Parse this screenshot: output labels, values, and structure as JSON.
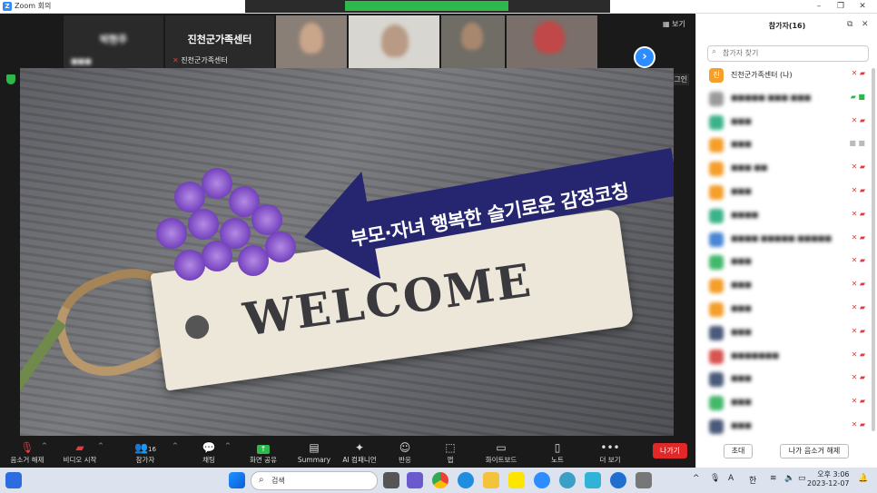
{
  "window": {
    "title": "Zoom 회의",
    "minimize": "–",
    "restore": "❐",
    "close": "✕"
  },
  "video_strip": {
    "tile1_name": "박현주",
    "host_tile_name": "진천군가족센터",
    "host_tile_label": "진천군가족센터",
    "view_label": "보기",
    "next_label": "›"
  },
  "share": {
    "login_label": "로그인",
    "banner_text": "부모·자녀 행복한 슬기로운 감정코칭",
    "tag_text": "WELCOME"
  },
  "toolbar": {
    "mute_label": "음소거 해제",
    "video_label": "비디오 시작",
    "participants_label": "참가자",
    "participants_count": "16",
    "chat_label": "채팅",
    "share_label": "화면 공유",
    "summary_label": "Summary",
    "ai_label": "AI 컴패니언",
    "reactions_label": "반응",
    "apps_label": "앱",
    "whiteboard_label": "화이트보드",
    "notes_label": "노트",
    "more_label": "더 보기",
    "leave_label": "나가기"
  },
  "panel": {
    "title": "참가자(16)",
    "search_placeholder": "참가자 찾기",
    "self": {
      "initial": "진",
      "name": "진천군가족센터 (나)"
    },
    "invite_label": "초대",
    "unmute_me_label": "나가 음소거 해제",
    "colors": {
      "orange": "#f59e2a",
      "teal": "#3bb38a",
      "green": "#43b86b",
      "blue": "#4a86d6",
      "navy": "#4a5a7a",
      "red": "#d9534f",
      "gray": "#9a9a9a"
    }
  },
  "taskbar": {
    "search_label": "검색",
    "ime_label": "한",
    "font_label": "A",
    "time": "오후 3:06",
    "date": "2023-12-07"
  }
}
